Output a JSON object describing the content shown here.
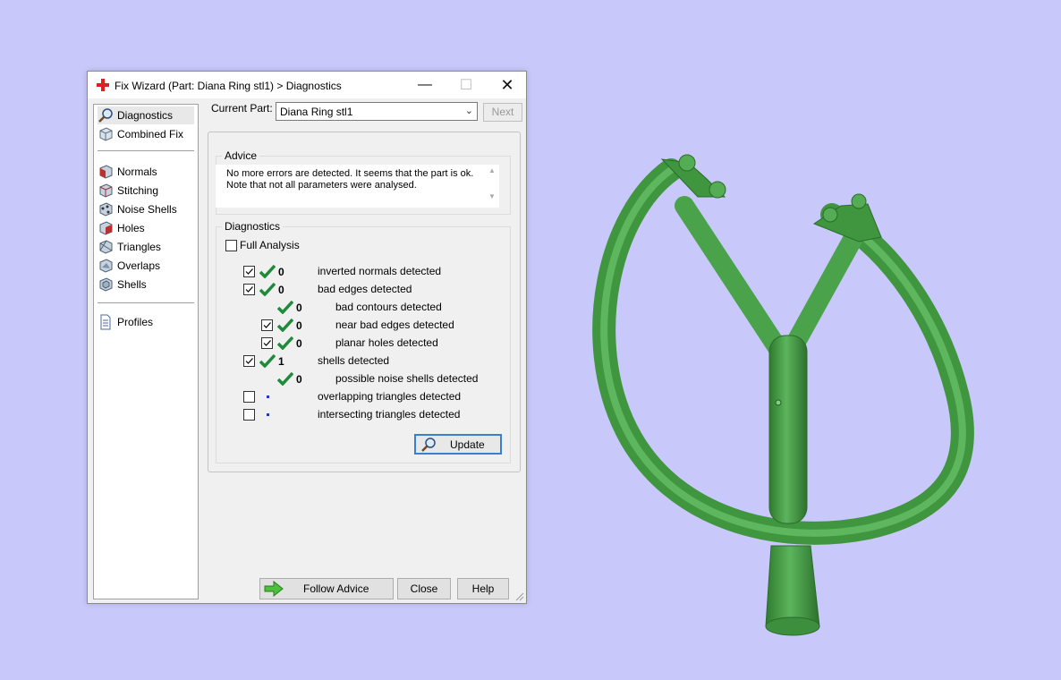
{
  "window": {
    "title": "Fix Wizard (Part: Diana Ring stl1) > Diagnostics",
    "minimize": "—",
    "maximize": "☐",
    "close": "✕"
  },
  "sidebar": {
    "items": [
      {
        "label": "Diagnostics",
        "icon": "magnifier-icon"
      },
      {
        "label": "Combined Fix",
        "icon": "cube-icon"
      },
      {
        "label": "Normals",
        "icon": "normals-cube-icon"
      },
      {
        "label": "Stitching",
        "icon": "stitching-cube-icon"
      },
      {
        "label": "Noise Shells",
        "icon": "noise-shells-icon"
      },
      {
        "label": "Holes",
        "icon": "holes-cube-icon"
      },
      {
        "label": "Triangles",
        "icon": "triangles-icon"
      },
      {
        "label": "Overlaps",
        "icon": "overlaps-icon"
      },
      {
        "label": "Shells",
        "icon": "shells-icon"
      },
      {
        "label": "Profiles",
        "icon": "document-icon"
      }
    ]
  },
  "current_part": {
    "label": "Current Part:",
    "value": "Diana Ring stl1"
  },
  "next_label": "Next",
  "advice": {
    "title": "Advice",
    "line1": "No more errors are detected. It seems that the part is ok.",
    "line2": "Note that not all parameters were analysed."
  },
  "diagnostics": {
    "title": "Diagnostics",
    "full_analysis": "Full Analysis",
    "rows": [
      {
        "count": "0",
        "label": "inverted normals detected"
      },
      {
        "count": "0",
        "label": "bad edges detected"
      },
      {
        "count": "0",
        "label": "bad contours detected"
      },
      {
        "count": "0",
        "label": "near bad edges detected"
      },
      {
        "count": "0",
        "label": "planar holes detected"
      },
      {
        "count": "1",
        "label": "shells detected"
      },
      {
        "count": "0",
        "label": "possible noise shells detected"
      },
      {
        "count": "",
        "label": "overlapping triangles detected"
      },
      {
        "count": "",
        "label": "intersecting triangles detected"
      }
    ]
  },
  "buttons": {
    "update": "Update",
    "follow_advice": "Follow Advice",
    "close": "Close",
    "help": "Help"
  },
  "colors": {
    "background": "#c8c8fa",
    "model_green": "#46a046",
    "check_green": "#1f8a3a",
    "accent_red": "#e02020"
  }
}
